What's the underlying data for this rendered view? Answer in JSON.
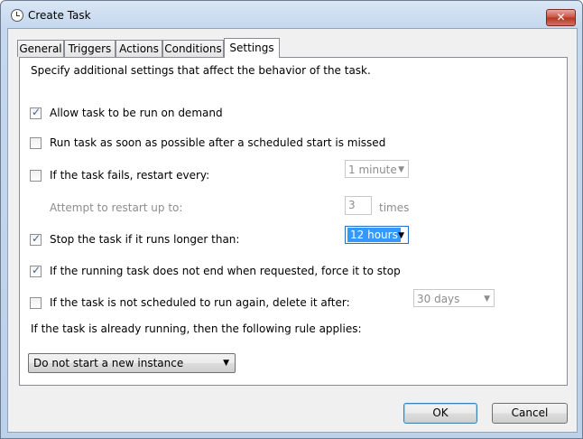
{
  "window": {
    "title": "Create Task",
    "close_label": "✕"
  },
  "tabs": [
    {
      "label": "General"
    },
    {
      "label": "Triggers"
    },
    {
      "label": "Actions"
    },
    {
      "label": "Conditions"
    },
    {
      "label": "Settings",
      "active": true
    }
  ],
  "settings": {
    "intro": "Specify additional settings that affect the behavior of the task.",
    "allow_on_demand": {
      "label": "Allow task to be run on demand",
      "checked": true
    },
    "run_asap": {
      "label": "Run task as soon as possible after a scheduled start is missed",
      "checked": false
    },
    "restart_on_fail": {
      "label": "If the task fails, restart every:",
      "checked": false,
      "interval": "1 minute"
    },
    "restart_attempts": {
      "label": "Attempt to restart up to:",
      "value": "3",
      "unit": "times"
    },
    "stop_if_longer": {
      "label": "Stop the task if it runs longer than:",
      "checked": true,
      "duration": "12 hours"
    },
    "force_stop": {
      "label": "If the running task does not end when requested, force it to stop",
      "checked": true
    },
    "delete_after": {
      "label": "If the task is not scheduled to run again, delete it after:",
      "checked": false,
      "duration": "30 days"
    },
    "rule_label": "If the task is already running, then the following rule applies:",
    "rule_value": "Do not start a new instance"
  },
  "buttons": {
    "ok": "OK",
    "cancel": "Cancel"
  },
  "icons": {
    "clock": "clock-icon",
    "dropdown": "chevron-down-icon",
    "check": "checkmark-icon"
  }
}
